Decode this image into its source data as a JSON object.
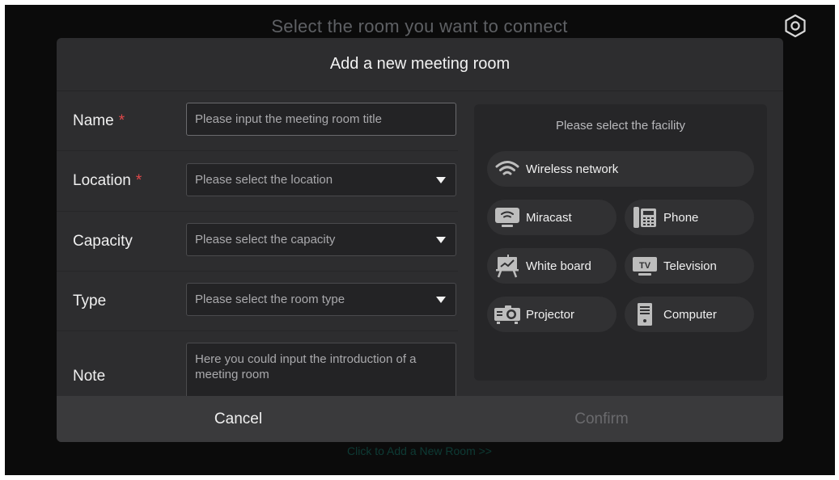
{
  "background": {
    "title": "Select the room you want to connect",
    "add_link": "Click to Add a New Room >>"
  },
  "dialog": {
    "title": "Add a new meeting room",
    "fields": {
      "name": {
        "label": "Name",
        "required_mark": "*",
        "value": "",
        "placeholder": "Please input the meeting room title"
      },
      "location": {
        "label": "Location",
        "required_mark": "*",
        "value": "Please select the location"
      },
      "capacity": {
        "label": "Capacity",
        "value": "Please select the capacity"
      },
      "type": {
        "label": "Type",
        "value": "Please select the room type"
      },
      "note": {
        "label": "Note",
        "value": "Here you could input the introduction of a meeting room"
      }
    },
    "facility": {
      "title": "Please select the facility",
      "items": [
        {
          "label": "Wireless network",
          "icon": "wifi-icon"
        },
        {
          "label": "Miracast",
          "icon": "miracast-icon"
        },
        {
          "label": "Phone",
          "icon": "phone-icon"
        },
        {
          "label": "White board",
          "icon": "whiteboard-icon"
        },
        {
          "label": "Television",
          "icon": "television-icon",
          "icon_text": "TV"
        },
        {
          "label": "Projector",
          "icon": "projector-icon"
        },
        {
          "label": "Computer",
          "icon": "computer-icon"
        }
      ]
    },
    "footer": {
      "cancel": "Cancel",
      "confirm": "Confirm"
    }
  },
  "colors": {
    "screen_bg": "#0b0b0b",
    "dialog_bg": "#2d2d2f",
    "footer_bg": "#3a3a3c",
    "required": "#e0484a",
    "disabled_text": "#6a6a6d",
    "link": "#0e3b35"
  }
}
